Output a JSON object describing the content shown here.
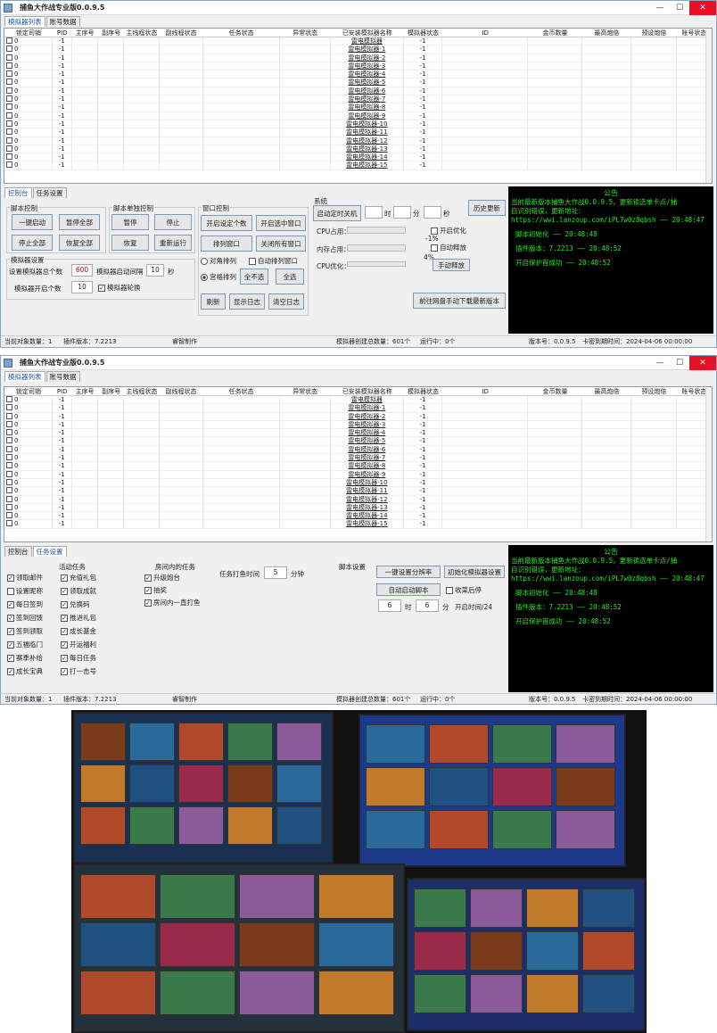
{
  "window1": {
    "title": "捕鱼大作战专业版0.0.9.5",
    "tabs": [
      "模拟器列表",
      "账号数据"
    ],
    "active_tab": 0
  },
  "window2": {
    "title": "捕鱼大作战专业版0.0.9.5",
    "tabs": [
      "模拟器列表",
      "账号数据"
    ],
    "active_tab": 0
  },
  "columns": [
    "锁定司销",
    "PID",
    "主序号",
    "副序号",
    "主线程状态",
    "副线程状态",
    "任务状态",
    "异常状态",
    "已安装模拟器名称",
    "模拟器状态",
    "ID",
    "金币数量",
    "最高炮倍",
    "预设炮倍",
    "账号状态"
  ],
  "rows": [
    {
      "lock": "0",
      "pid": "-1",
      "name": "雷电模拟器",
      "state": "-1"
    },
    {
      "lock": "0",
      "pid": "-1",
      "name": "雷电模拟器-1",
      "state": "-1"
    },
    {
      "lock": "0",
      "pid": "-1",
      "name": "雷电模拟器-2",
      "state": "-1"
    },
    {
      "lock": "0",
      "pid": "-1",
      "name": "雷电模拟器-3",
      "state": "-1"
    },
    {
      "lock": "0",
      "pid": "-1",
      "name": "雷电模拟器-4",
      "state": "-1"
    },
    {
      "lock": "0",
      "pid": "-1",
      "name": "雷电模拟器-5",
      "state": "-1"
    },
    {
      "lock": "0",
      "pid": "-1",
      "name": "雷电模拟器-6",
      "state": "-1"
    },
    {
      "lock": "0",
      "pid": "-1",
      "name": "雷电模拟器-7",
      "state": "-1"
    },
    {
      "lock": "0",
      "pid": "-1",
      "name": "雷电模拟器-8",
      "state": "-1"
    },
    {
      "lock": "0",
      "pid": "-1",
      "name": "雷电模拟器-9",
      "state": "-1"
    },
    {
      "lock": "0",
      "pid": "-1",
      "name": "雷电模拟器-10",
      "state": "-1"
    },
    {
      "lock": "0",
      "pid": "-1",
      "name": "雷电模拟器-11",
      "state": "-1"
    },
    {
      "lock": "0",
      "pid": "-1",
      "name": "雷电模拟器-12",
      "state": "-1"
    },
    {
      "lock": "0",
      "pid": "-1",
      "name": "雷电模拟器-13",
      "state": "-1"
    },
    {
      "lock": "0",
      "pid": "-1",
      "name": "雷电模拟器-14",
      "state": "-1"
    },
    {
      "lock": "0",
      "pid": "-1",
      "name": "雷电模拟器-15",
      "state": "-1"
    }
  ],
  "ctrl_tabs": [
    "控制台",
    "任务设置"
  ],
  "script_ctrl": {
    "title": "脚本控制",
    "start_all": "一键启动",
    "pause_all": "暂停全部",
    "stop_all": "停止全部",
    "resume_all": "恢复全部"
  },
  "single_ctrl": {
    "title": "脚本单独控制",
    "pause": "暂停",
    "stop": "停止",
    "resume": "恢复",
    "restart": "重新运行"
  },
  "window_ctrl": {
    "title": "窗口控制",
    "open_n": "开启设定个数",
    "open_sel": "开启选中窗口",
    "arrange": "排列窗口",
    "close_all": "关闭所有窗口",
    "diag": "对角排列",
    "auto_arrange": "自动排列窗口",
    "grid": "宫格排列",
    "select_none": "全不选",
    "select_all": "全选",
    "refresh": "刷新",
    "show_log": "显示日志",
    "clear_log": "清空日志"
  },
  "emu_settings": {
    "title": "模拟器设置",
    "total_label": "设置模拟器总个数",
    "total": "600",
    "interval_label": "模拟器启动间隔",
    "interval": "10",
    "sec": "秒",
    "open_count_label": "模拟器开启个数",
    "open_count": "10",
    "rotate": "模拟器轮换"
  },
  "system": {
    "title": "系统",
    "shutdown": "启动定时关机",
    "hour": "时",
    "minute": "分",
    "second": "秒",
    "history": "历史更新",
    "cpu": "CPU占用：",
    "cpu_pct": "-1%",
    "mem": "内存占用：",
    "mem_pct": "4%",
    "cpu_opt": "CPU优化：",
    "enable_opt": "开启优化",
    "auto_release": "自动释放",
    "manual_release": "手动释放",
    "download": "前往网盘手动下载最新版本"
  },
  "notice": {
    "title": "公告",
    "lines": [
      "当前最新版本捕鱼大作战0.0.9.5，更新锁选单卡点/捕",
      "自识别错误，更新地址：",
      "https://wwi.lanzoup.com/iPL7w0z8qbsh —— 20:48:47",
      "脚本初始化 —— 20:48:48",
      "插件版本：7.2213 —— 20:48:52",
      "开启保护首成功 —— 20:48:52"
    ]
  },
  "status1": {
    "objects": "当前对象数量：1",
    "plugin": "插件版本：7.2213",
    "author": "睿智制作",
    "total_emu": "模拟器创建总数量：601个",
    "running": "运行中：0个",
    "version": "版本号：0.0.9.5",
    "expire": "卡密到期时间：2024-04-06 00:00:00"
  },
  "tasks": {
    "title": "活动任务",
    "items": [
      {
        "label": "领取邮件",
        "checked": true
      },
      {
        "label": "充值礼包",
        "checked": true
      },
      {
        "label": "设置昵称",
        "checked": false
      },
      {
        "label": "领取成就",
        "checked": true
      },
      {
        "label": "每日签到",
        "checked": true
      },
      {
        "label": "兑换码",
        "checked": true
      },
      {
        "label": "签到回馈",
        "checked": true
      },
      {
        "label": "推进礼包",
        "checked": true
      },
      {
        "label": "签到领取",
        "checked": true
      },
      {
        "label": "成长基金",
        "checked": true
      },
      {
        "label": "五福临门",
        "checked": true
      },
      {
        "label": "开运福利",
        "checked": true
      },
      {
        "label": "赛季补给",
        "checked": true
      },
      {
        "label": "每日任务",
        "checked": true
      },
      {
        "label": "成长宝典",
        "checked": true
      },
      {
        "label": "打一击号",
        "checked": true
      }
    ]
  },
  "room_tasks": {
    "title": "房间内的任务",
    "items": [
      {
        "label": "升级炮台",
        "checked": true
      },
      {
        "label": "抽奖",
        "checked": true
      },
      {
        "label": "房间内一直打鱼",
        "checked": true
      }
    ],
    "fish_time_label": "任务打鱼时间",
    "fish_time": "5",
    "minute": "分钟"
  },
  "script_settings": {
    "title": "脚本设置",
    "one_key": "一键设置分辨率",
    "init_emu": "初始化模拟器设置",
    "auto_start": "自动启动脚本",
    "close_restart": "收菜后停",
    "h": "6",
    "hour": "时",
    "m": "6",
    "min": "分",
    "daily": "开启时间/24"
  },
  "status2": {
    "objects": "当前对象数量：1",
    "plugin": "插件版本：7.2213",
    "author": "睿智制作",
    "total_emu": "模拟器创建总数量：601个",
    "running": "运行中：0个",
    "version": "版本号：0.0.9.5",
    "expire": "卡密到期时间：2024-04-06 00:00:00"
  }
}
